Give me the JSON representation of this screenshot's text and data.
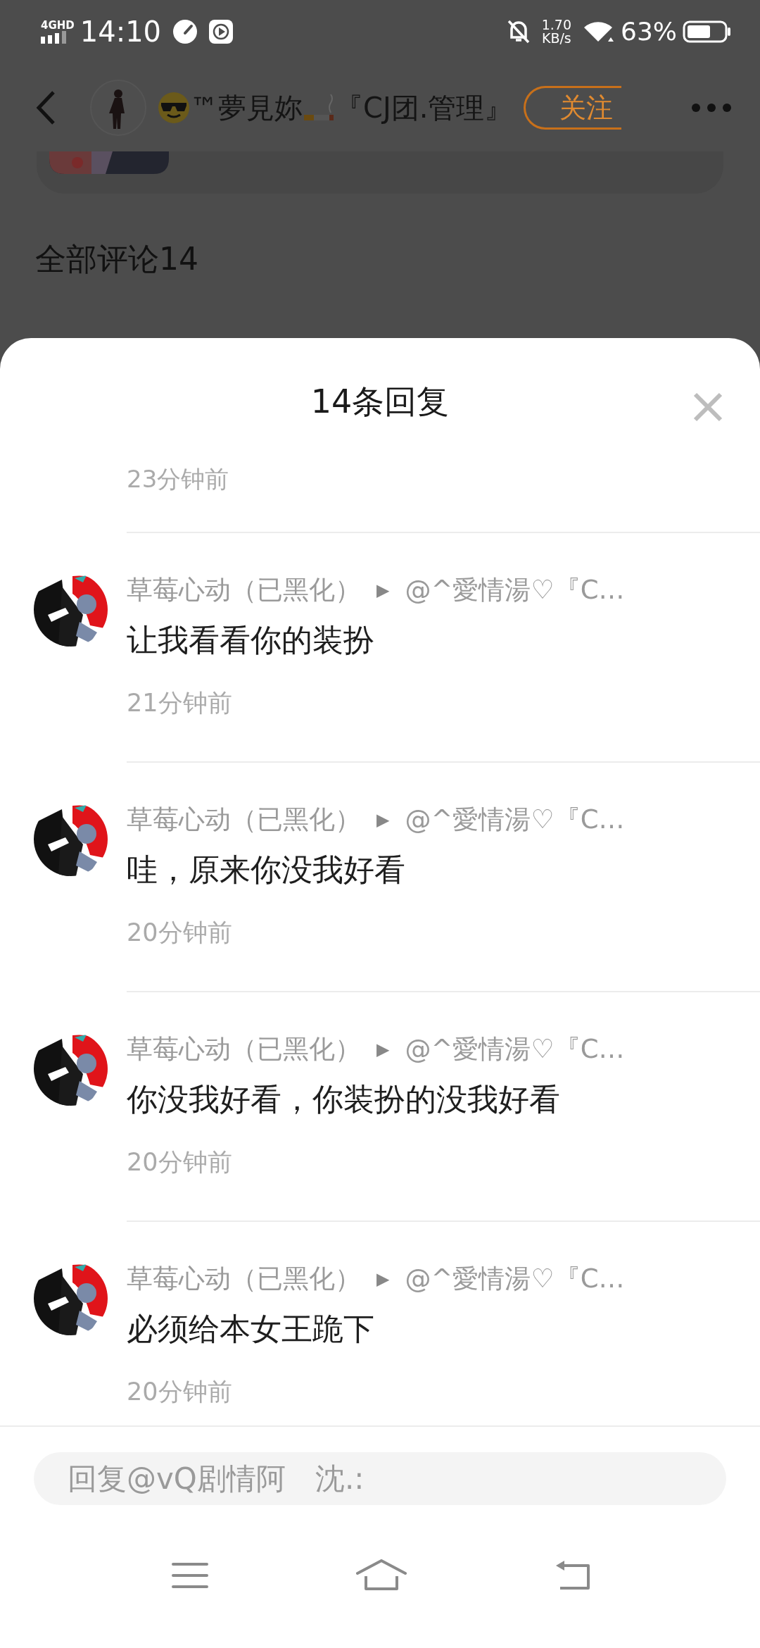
{
  "status_bar": {
    "network": "4GHD",
    "time": "14:10",
    "speed": "1.70",
    "speed_unit": "KB/s",
    "battery": "63%"
  },
  "header": {
    "title_parts": [
      "™夢見妳",
      "『CJ团.管理』"
    ],
    "follow": "关注"
  },
  "comments_heading": "全部评论14",
  "sheet": {
    "title": "14条回复",
    "partial_time": "23分钟前",
    "replies": [
      {
        "author": "草莓心动（已黑化）",
        "arrow": "▶",
        "reply_to": "@^愛情湯♡『C…",
        "text": "让我看看你的装扮",
        "time": "21分钟前"
      },
      {
        "author": "草莓心动（已黑化）",
        "arrow": "▶",
        "reply_to": "@^愛情湯♡『C…",
        "text": "哇，原来你没我好看",
        "time": "20分钟前"
      },
      {
        "author": "草莓心动（已黑化）",
        "arrow": "▶",
        "reply_to": "@^愛情湯♡『C…",
        "text": "你没我好看，你装扮的没我好看",
        "time": "20分钟前"
      },
      {
        "author": "草莓心动（已黑化）",
        "arrow": "▶",
        "reply_to": "@^愛情湯♡『C…",
        "text": "必须给本女王跪下",
        "time": "20分钟前"
      }
    ]
  },
  "reply_box": {
    "placeholder": "回复@vQ剧情阿　沈.:"
  }
}
